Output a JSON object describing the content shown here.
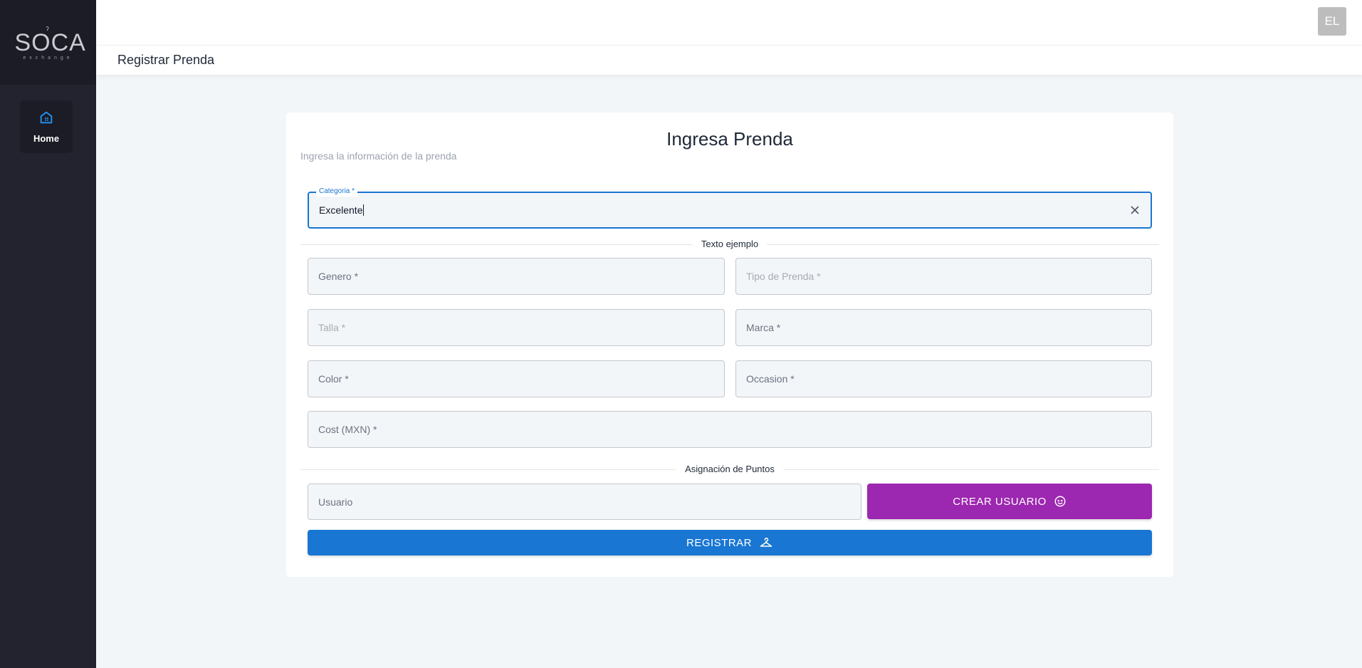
{
  "sidebar": {
    "logo": {
      "main": "SOCA",
      "sub": "exchange"
    },
    "nav": [
      {
        "label": "Home",
        "icon": "home-icon",
        "active": true
      }
    ]
  },
  "header": {
    "avatar_initials": "EL"
  },
  "breadcrumb": {
    "title": "Registrar Prenda"
  },
  "form": {
    "title": "Ingresa Prenda",
    "subtitle": "Ingresa la información de la prenda",
    "categoria": {
      "label": "Categoria *",
      "value": "Excelente"
    },
    "section_one": "Texto ejemplo",
    "fields": {
      "genero": "Genero *",
      "tipo_prenda": "Tipo de Prenda *",
      "talla": "Talla *",
      "marca": "Marca *",
      "color": "Color *",
      "occasion": "Occasion *",
      "cost": "Cost (MXN) *"
    },
    "section_two": "Asignación de Puntos",
    "usuario": "Usuario",
    "crear_usuario_label": "CREAR USUARIO",
    "registrar_label": "REGISTRAR"
  },
  "colors": {
    "accent_blue": "#1976d2",
    "accent_purple": "#9c27b0",
    "sidebar_bg": "#23232f"
  }
}
